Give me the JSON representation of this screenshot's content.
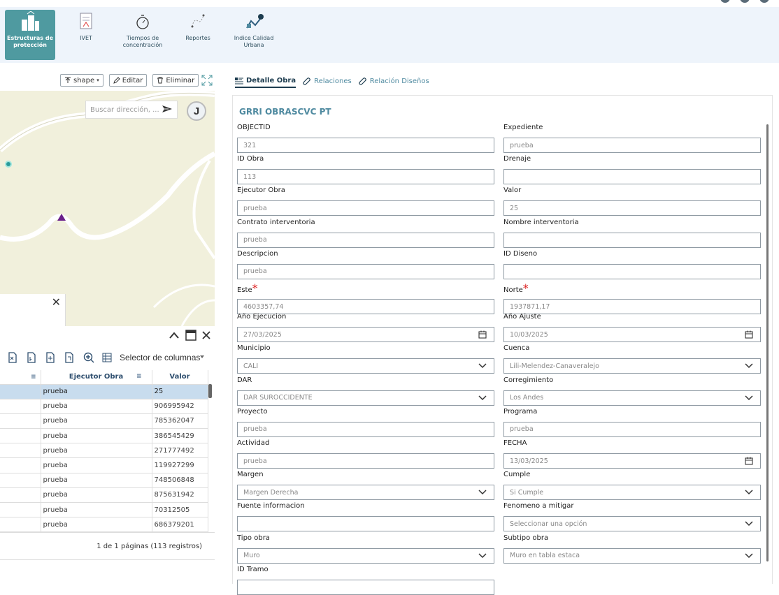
{
  "toolbar": {
    "items": [
      {
        "label": "Estructuras de protección",
        "icon": "buildings-icon"
      },
      {
        "label": "IVET",
        "icon": "document-icon"
      },
      {
        "label": "Tiempos de concentración",
        "icon": "stopwatch-icon"
      },
      {
        "label": "Reportes",
        "icon": "chart-icon"
      },
      {
        "label": "Indice Calidad Urbana",
        "icon": "city-quality-icon"
      }
    ]
  },
  "map_panel": {
    "buttons": {
      "shape": "shape",
      "edit": "Editar",
      "delete": "Eliminar"
    },
    "search": {
      "placeholder": "Buscar dirección, ..."
    },
    "user_initial": "J",
    "popup_close": "✕"
  },
  "grid": {
    "column_selector": "Selector de columnas",
    "columns": [
      "",
      "Ejecutor Obra",
      "Valor"
    ],
    "rows": [
      {
        "ejecutor": "prueba",
        "valor": "25"
      },
      {
        "ejecutor": "prueba",
        "valor": "906995942"
      },
      {
        "ejecutor": "prueba",
        "valor": "785362047"
      },
      {
        "ejecutor": "prueba",
        "valor": "386545429"
      },
      {
        "ejecutor": "prueba",
        "valor": "271777492"
      },
      {
        "ejecutor": "prueba",
        "valor": "119927299"
      },
      {
        "ejecutor": "prueba",
        "valor": "748506848"
      },
      {
        "ejecutor": "prueba",
        "valor": "875631942"
      },
      {
        "ejecutor": "prueba",
        "valor": "70312505"
      },
      {
        "ejecutor": "prueba",
        "valor": "686379201"
      }
    ],
    "pager": "1 de 1 páginas (113 registros)"
  },
  "tabs": [
    {
      "label": "Detalle Obra",
      "active": true
    },
    {
      "label": "Relaciones",
      "active": false
    },
    {
      "label": "Relación Diseños",
      "active": false
    }
  ],
  "form": {
    "title": "GRRI OBRASCVC PT",
    "fields": [
      {
        "label": "OBJECTID",
        "value": "321",
        "type": "text"
      },
      {
        "label": "Expediente",
        "value": "prueba",
        "type": "text"
      },
      {
        "label": "ID Obra",
        "value": "113",
        "type": "text"
      },
      {
        "label": "Drenaje",
        "value": "",
        "type": "text"
      },
      {
        "label": "Ejecutor Obra",
        "value": "prueba",
        "type": "text"
      },
      {
        "label": "Valor",
        "value": "25",
        "type": "text"
      },
      {
        "label": "Contrato interventoria",
        "value": "prueba",
        "type": "text"
      },
      {
        "label": "Nombre interventoria",
        "value": "",
        "type": "text"
      },
      {
        "label": "Descripcion",
        "value": "prueba",
        "type": "text"
      },
      {
        "label": "ID Diseno",
        "value": "",
        "type": "text"
      },
      {
        "label": "Este",
        "value": "4603357,74",
        "type": "text",
        "required": true
      },
      {
        "label": "Norte",
        "value": "1937871,17",
        "type": "text",
        "required": true
      },
      {
        "label": "Año Ejecucion",
        "value": "27/03/2025",
        "type": "date"
      },
      {
        "label": "Año Ajuste",
        "value": "10/03/2025",
        "type": "date"
      },
      {
        "label": "Municipio",
        "value": "CALI",
        "type": "select"
      },
      {
        "label": "Cuenca",
        "value": "Lili-Melendez-Canaveralejo",
        "type": "select"
      },
      {
        "label": "DAR",
        "value": "DAR SUROCCIDENTE",
        "type": "select"
      },
      {
        "label": "Corregimiento",
        "value": "Los Andes",
        "type": "select"
      },
      {
        "label": "Proyecto",
        "value": "prueba",
        "type": "text"
      },
      {
        "label": "Programa",
        "value": "prueba",
        "type": "text"
      },
      {
        "label": "Actividad",
        "value": "prueba",
        "type": "text"
      },
      {
        "label": "FECHA",
        "value": "13/03/2025",
        "type": "date"
      },
      {
        "label": "Margen",
        "value": "Margen Derecha",
        "type": "select"
      },
      {
        "label": "Cumple",
        "value": "Si Cumple",
        "type": "select"
      },
      {
        "label": "Fuente informacion",
        "value": "",
        "type": "text"
      },
      {
        "label": "Fenomeno a mitigar",
        "value": "Seleccionar una opción",
        "type": "select"
      },
      {
        "label": "Tipo obra",
        "value": "Muro",
        "type": "select"
      },
      {
        "label": "Subtipo obra",
        "value": "Muro en tabla estaca",
        "type": "select"
      },
      {
        "label": "ID Tramo",
        "value": "",
        "type": "text"
      }
    ]
  },
  "colors": {
    "accent": "#4f9aa0",
    "toolbar_bg": "#eef4fb",
    "selected_row": "#c8dcee",
    "map_bg": "#f1f0dc"
  }
}
